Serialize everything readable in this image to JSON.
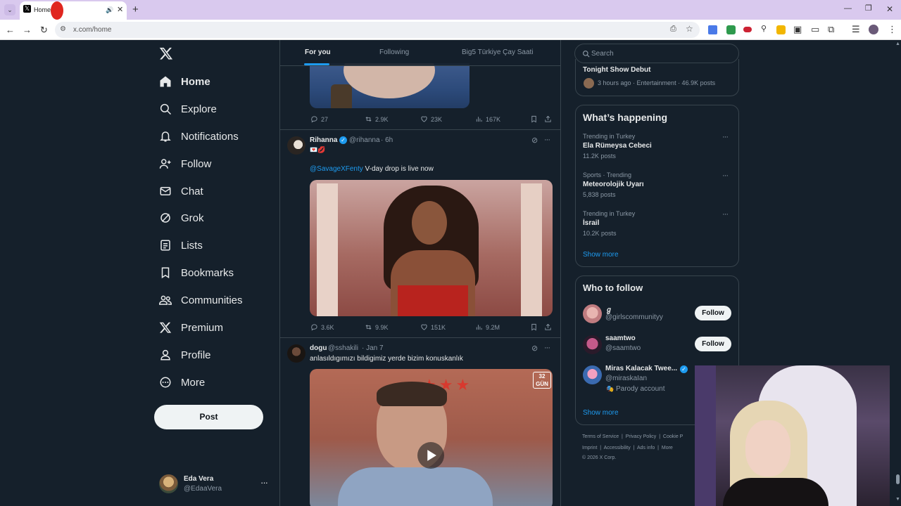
{
  "browser": {
    "tab_title": "Home",
    "url": "x.com/home"
  },
  "nav": {
    "items": [
      {
        "label": "Home"
      },
      {
        "label": "Explore"
      },
      {
        "label": "Notifications"
      },
      {
        "label": "Follow"
      },
      {
        "label": "Chat"
      },
      {
        "label": "Grok"
      },
      {
        "label": "Lists"
      },
      {
        "label": "Bookmarks"
      },
      {
        "label": "Communities"
      },
      {
        "label": "Premium"
      },
      {
        "label": "Profile"
      },
      {
        "label": "More"
      }
    ],
    "post_label": "Post",
    "account": {
      "name": "Eda Vera",
      "handle": "@EdaaVera"
    }
  },
  "tabs": [
    {
      "label": "For you"
    },
    {
      "label": "Following"
    },
    {
      "label": "Big5 Türkiye Çay Saati"
    }
  ],
  "posts": [
    {
      "actions": {
        "replies": "27",
        "reposts": "2.9K",
        "likes": "23K",
        "views": "167K"
      }
    },
    {
      "name": "Rihanna",
      "handle": "@rihanna",
      "time": "· 6h",
      "emoji": "💌💋",
      "mention": "@SavageXFenty",
      "text": " V-day drop is live now",
      "actions": {
        "replies": "3.6K",
        "reposts": "9.9K",
        "likes": "151K",
        "views": "9.2M"
      }
    },
    {
      "name": "dogu",
      "handle": "@sshakili",
      "time": "· Jan 7",
      "text": "anlasıldıgımızı bildigimiz yerde bizim konuskanlık",
      "badge": "32 GÜN"
    }
  ],
  "search": {
    "placeholder": "Search"
  },
  "top_trend": {
    "title": "Tonight Show Debut",
    "meta": "3 hours ago · Entertainment · 46.9K posts"
  },
  "happening": {
    "title": "What’s happening",
    "trends": [
      {
        "context": "Trending in Turkey",
        "name": "Ela Rümeysa Cebeci",
        "count": "11.2K posts"
      },
      {
        "context": "Sports · Trending",
        "name": "Meteorolojik Uyarı",
        "count": "5,838 posts"
      },
      {
        "context": "Trending in Turkey",
        "name": "İsrail",
        "count": "10.2K posts"
      }
    ],
    "show_more": "Show more"
  },
  "who_to_follow": {
    "title": "Who to follow",
    "users": [
      {
        "name": "ℊ",
        "handle": "@girlscommunityy",
        "button": "Follow"
      },
      {
        "name": "saamtwo",
        "handle": "@saamtwo",
        "button": "Follow"
      },
      {
        "name": "Miras Kalacak Twee...",
        "handle": "@miraskaIan",
        "note": "Parody account"
      }
    ],
    "show_more": "Show more"
  },
  "footer": {
    "links": [
      "Terms of Service",
      "Privacy Policy",
      "Cookie P",
      "Imprint",
      "Accessibility",
      "Ads info",
      "More"
    ],
    "copyright": "© 2026 X Corp."
  },
  "colors": {
    "background": "#15202b",
    "accent": "#1d9bf0",
    "border": "#38444d",
    "muted": "#8b98a5"
  }
}
